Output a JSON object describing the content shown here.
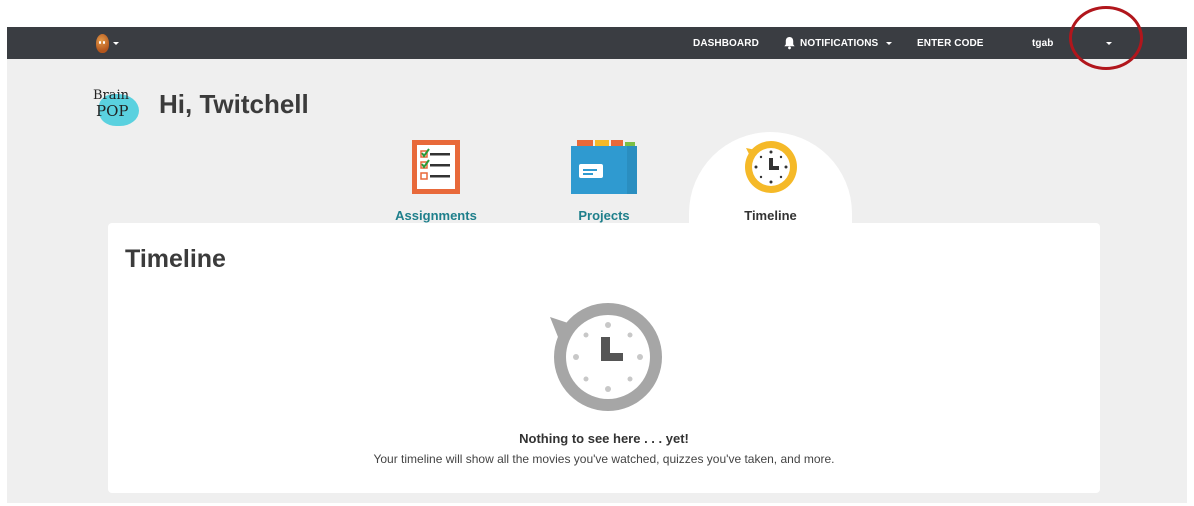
{
  "nav": {
    "dashboard": "DASHBOARD",
    "notifications": "NOTIFICATIONS",
    "enter_code": "ENTER CODE",
    "username": "tgab"
  },
  "header": {
    "logo_line1": "Brain",
    "logo_line2": "POP",
    "greeting": "Hi, Twitchell"
  },
  "tabs": [
    {
      "label": "Assignments",
      "icon": "checklist-icon",
      "active": false
    },
    {
      "label": "Projects",
      "icon": "folder-icon",
      "active": false
    },
    {
      "label": "Timeline",
      "icon": "clock-icon",
      "active": true
    }
  ],
  "panel": {
    "title": "Timeline",
    "empty_title": "Nothing to see here . . . yet!",
    "empty_description": "Your timeline will show all the movies you've watched, quizzes you've taken, and more."
  },
  "colors": {
    "topbar": "#3a3d42",
    "tab_link": "#1e7f8b",
    "annotation": "#b1161c",
    "assignments_orange": "#e8693a",
    "projects_blue": "#2a8ec0",
    "timeline_yellow": "#f5b928"
  }
}
